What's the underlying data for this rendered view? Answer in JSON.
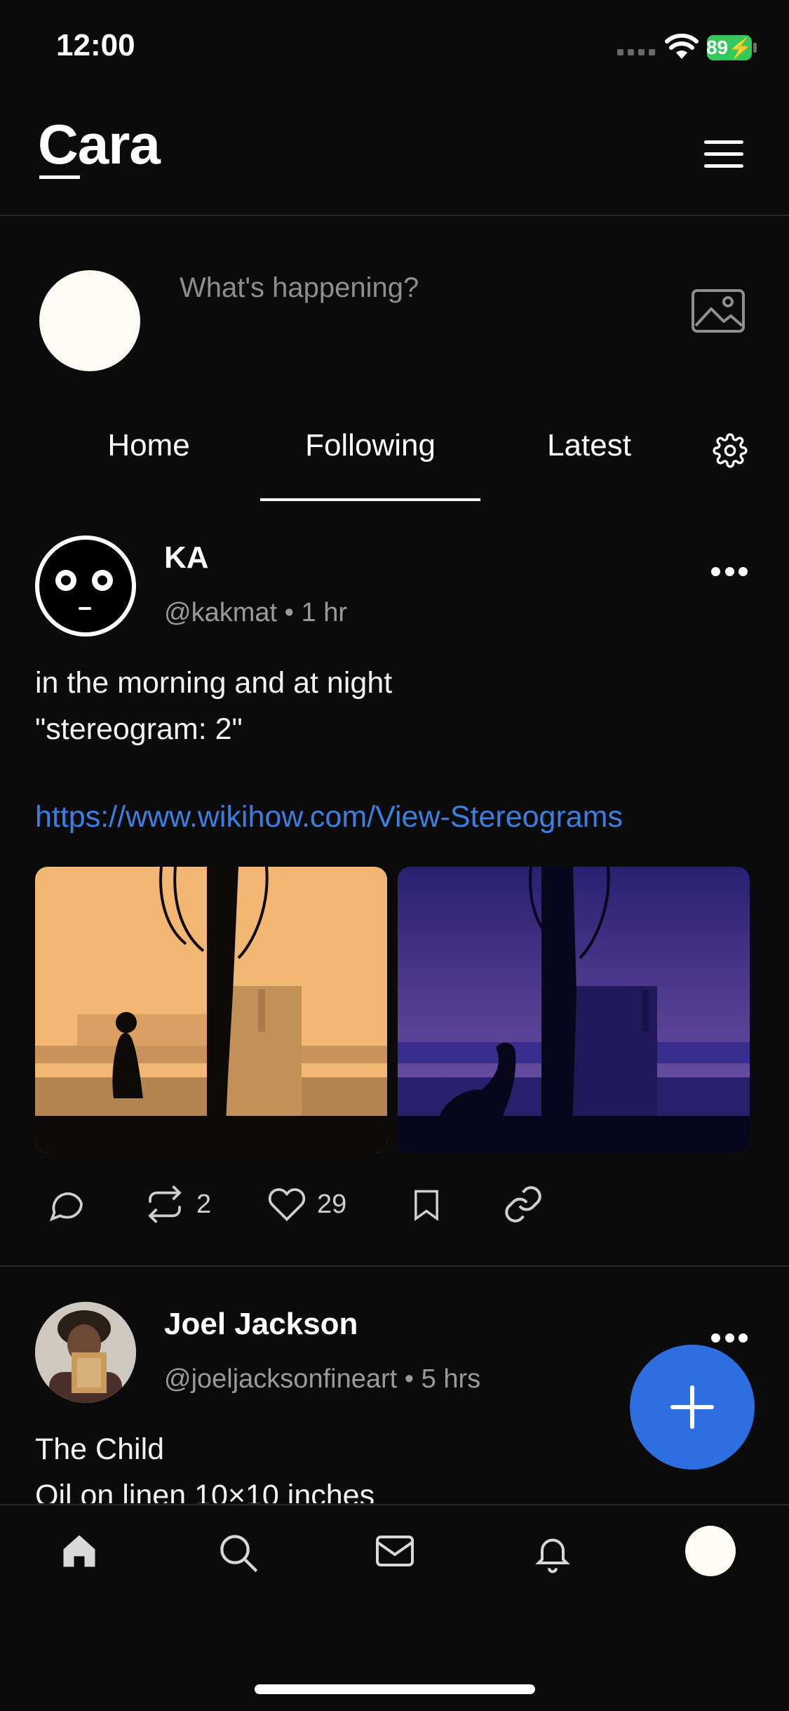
{
  "status": {
    "time": "12:00",
    "battery": "89"
  },
  "app": {
    "logo": "Cara"
  },
  "composer": {
    "placeholder": "What's happening?"
  },
  "tabs": [
    {
      "label": "Home",
      "active": false
    },
    {
      "label": "Following",
      "active": true
    },
    {
      "label": "Latest",
      "active": false
    }
  ],
  "posts": [
    {
      "author": "KA",
      "handle": "@kakmat",
      "time": "1 hr",
      "text": "in the morning and at night\n\"stereogram: 2\"",
      "link": "https://www.wikihow.com/View-Stereograms",
      "reposts": "2",
      "likes": "29"
    },
    {
      "author": "Joel Jackson",
      "handle": "@joeljacksonfineart",
      "time": "5 hrs",
      "text": "The Child\nOil on linen 10×10 inches"
    }
  ],
  "colors": {
    "accent": "#2d6fe0",
    "link": "#3b7fe0",
    "battery": "#34c759",
    "background": "#0b0b0c"
  },
  "nav": [
    "home-icon",
    "search-icon",
    "mail-icon",
    "bell-icon",
    "profile-avatar"
  ]
}
